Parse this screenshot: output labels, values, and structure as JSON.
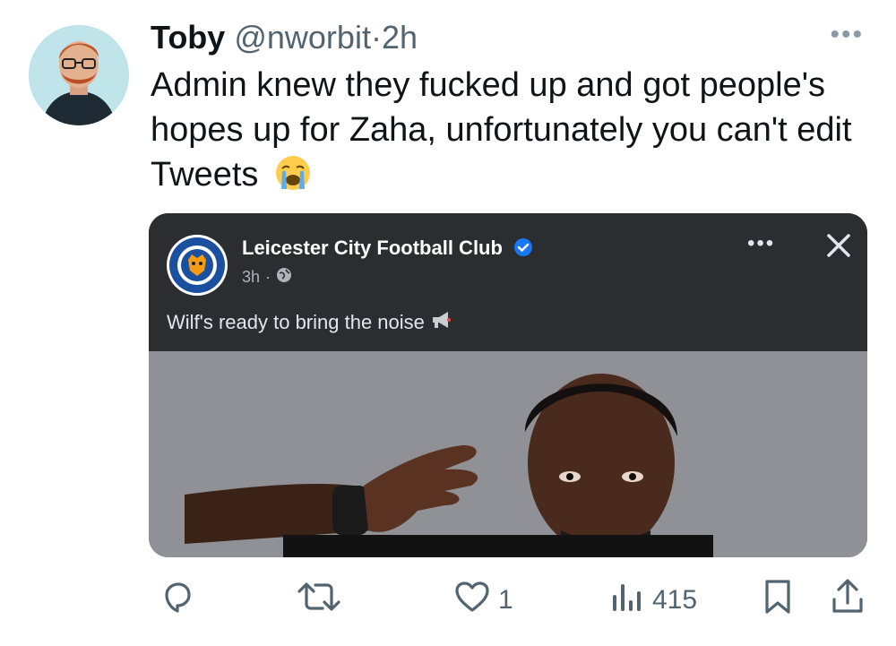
{
  "tweet": {
    "author_name": "Toby",
    "handle": "@nworbit",
    "separator": "·",
    "time": "2h",
    "more_label": "•••",
    "text": "Admin knew they fucked up and got people's hopes up for Zaha, unfortunately you can't edit Tweets",
    "emoji": "loudly-crying-face"
  },
  "embedded_post": {
    "page_name": "Leicester City Football Club",
    "time": "3h",
    "meta_sep": "·",
    "caption": "Wilf's ready to bring the noise",
    "caption_emoji": "megaphone-icon",
    "more_label": "•••"
  },
  "actions": {
    "reply_count": "",
    "retweet_count": "",
    "like_count": "1",
    "views_count": "415"
  },
  "colors": {
    "text": "#0f1419",
    "muted": "#536471",
    "fb_bg": "#2b2d31",
    "verified": "#1877f2"
  }
}
